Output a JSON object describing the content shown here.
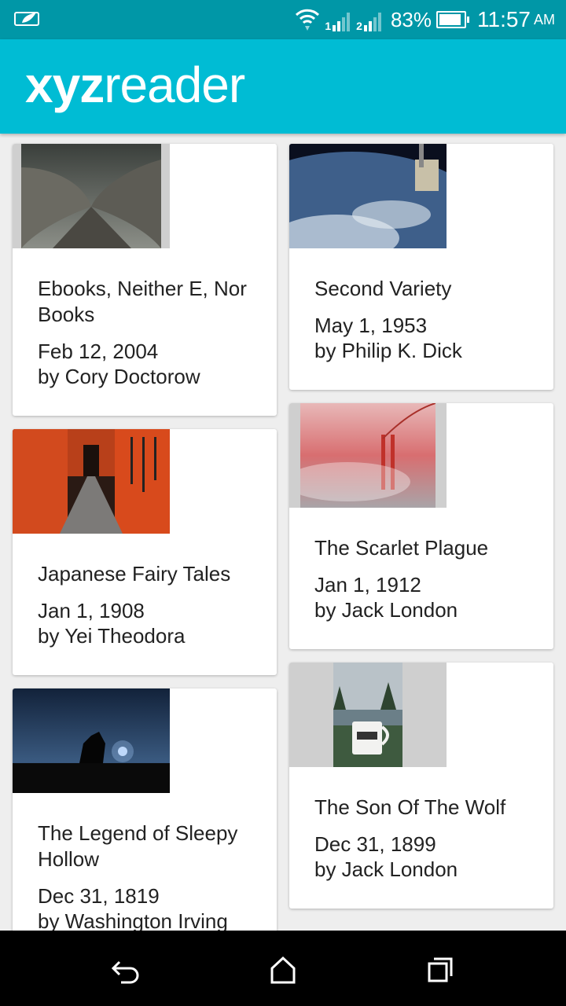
{
  "status_bar": {
    "battery": "83%",
    "time": "11:57",
    "ampm": "AM",
    "sim1": "1",
    "sim2": "2"
  },
  "app": {
    "logo_bold": "xyz",
    "logo_regular": "reader"
  },
  "articles": [
    {
      "title": "Ebooks, Neither E, Nor Books",
      "date": "Feb 12, 2004",
      "author": "by Cory Doctorow"
    },
    {
      "title": "Second Variety",
      "date": "May 1, 1953",
      "author": "by Philip K. Dick"
    },
    {
      "title": "Japanese Fairy Tales",
      "date": "Jan 1, 1908",
      "author": "by Yei Theodora"
    },
    {
      "title": "The Scarlet Plague",
      "date": "Jan 1, 1912",
      "author": "by Jack London"
    },
    {
      "title": "The Legend of Sleepy Hollow",
      "date": "Dec 31, 1819",
      "author": "by Washington Irving"
    },
    {
      "title": "The Son Of The Wolf",
      "date": "Dec 31, 1899",
      "author": "by Jack London"
    }
  ],
  "nav": {
    "back": "back-icon",
    "home": "home-icon",
    "recents": "recents-icon"
  }
}
